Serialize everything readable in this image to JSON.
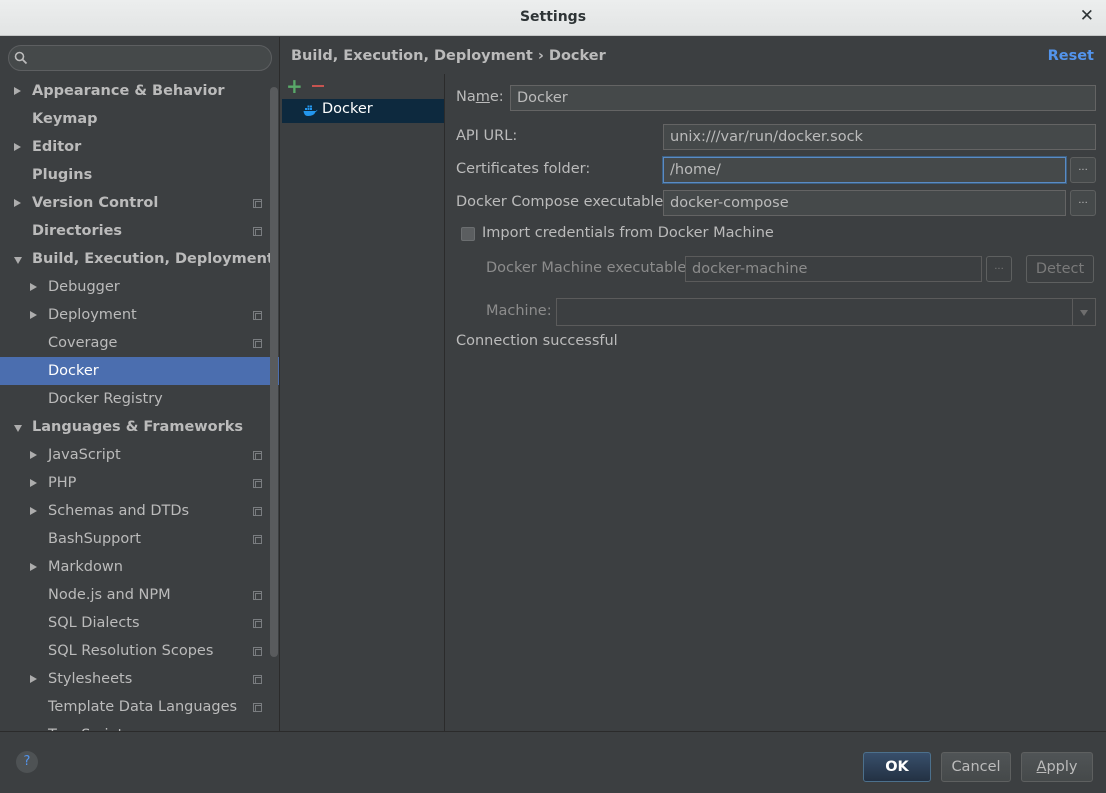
{
  "window": {
    "title": "Settings"
  },
  "search": {
    "placeholder": ""
  },
  "sidebar": {
    "items": [
      {
        "label": "Appearance & Behavior",
        "level": 0,
        "arrow": "right",
        "bold": true,
        "project": false
      },
      {
        "label": "Keymap",
        "level": 0,
        "arrow": "none",
        "bold": true,
        "project": false
      },
      {
        "label": "Editor",
        "level": 0,
        "arrow": "right",
        "bold": true,
        "project": false
      },
      {
        "label": "Plugins",
        "level": 0,
        "arrow": "none",
        "bold": true,
        "project": false
      },
      {
        "label": "Version Control",
        "level": 0,
        "arrow": "right",
        "bold": true,
        "project": true
      },
      {
        "label": "Directories",
        "level": 0,
        "arrow": "none",
        "bold": true,
        "project": true
      },
      {
        "label": "Build, Execution, Deployment",
        "level": 0,
        "arrow": "down",
        "bold": true,
        "project": false
      },
      {
        "label": "Debugger",
        "level": 1,
        "arrow": "right",
        "bold": false,
        "project": false
      },
      {
        "label": "Deployment",
        "level": 1,
        "arrow": "right",
        "bold": false,
        "project": true
      },
      {
        "label": "Coverage",
        "level": 1,
        "arrow": "none",
        "bold": false,
        "project": true
      },
      {
        "label": "Docker",
        "level": 1,
        "arrow": "none",
        "bold": false,
        "project": false,
        "selected": true
      },
      {
        "label": "Docker Registry",
        "level": 1,
        "arrow": "none",
        "bold": false,
        "project": false
      },
      {
        "label": "Languages & Frameworks",
        "level": 0,
        "arrow": "down",
        "bold": true,
        "project": false
      },
      {
        "label": "JavaScript",
        "level": 1,
        "arrow": "right",
        "bold": false,
        "project": true
      },
      {
        "label": "PHP",
        "level": 1,
        "arrow": "right",
        "bold": false,
        "project": true
      },
      {
        "label": "Schemas and DTDs",
        "level": 1,
        "arrow": "right",
        "bold": false,
        "project": true
      },
      {
        "label": "BashSupport",
        "level": 1,
        "arrow": "none",
        "bold": false,
        "project": true
      },
      {
        "label": "Markdown",
        "level": 1,
        "arrow": "right",
        "bold": false,
        "project": false
      },
      {
        "label": "Node.js and NPM",
        "level": 1,
        "arrow": "none",
        "bold": false,
        "project": true
      },
      {
        "label": "SQL Dialects",
        "level": 1,
        "arrow": "none",
        "bold": false,
        "project": true
      },
      {
        "label": "SQL Resolution Scopes",
        "level": 1,
        "arrow": "none",
        "bold": false,
        "project": true
      },
      {
        "label": "Stylesheets",
        "level": 1,
        "arrow": "right",
        "bold": false,
        "project": true
      },
      {
        "label": "Template Data Languages",
        "level": 1,
        "arrow": "none",
        "bold": false,
        "project": true
      },
      {
        "label": "TypeScript",
        "level": 1,
        "arrow": "none",
        "bold": false,
        "project": false
      }
    ]
  },
  "header": {
    "breadcrumb": "Build, Execution, Deployment › Docker",
    "reset_label": "Reset"
  },
  "servers": {
    "add_icon": "plus-icon",
    "remove_icon": "minus-icon",
    "items": [
      {
        "label": "Docker",
        "icon": "docker-whale-icon"
      }
    ]
  },
  "form": {
    "name_label_pre": "Na",
    "name_label_mnemonic": "m",
    "name_label_post": "e:",
    "name_value": "Docker",
    "api_url_label": "API URL:",
    "api_url_value": "unix:///var/run/docker.sock",
    "cert_label": "Certificates folder:",
    "cert_value": "/home/",
    "compose_label": "Docker Compose executable:",
    "compose_value": "docker-compose",
    "browse_label": "...",
    "import_label": "Import credentials from Docker Machine",
    "import_checked": false,
    "machine_exec_label": "Docker Machine executable:",
    "machine_exec_value": "docker-machine",
    "detect_label": "Detect",
    "machine_label": "Machine:",
    "machine_value": "",
    "status": "Connection successful"
  },
  "footer": {
    "help_label": "?",
    "ok_label": "OK",
    "cancel_label": "Cancel",
    "apply_label_mnemonic": "A",
    "apply_label_rest": "pply"
  },
  "colors": {
    "selection": "#4b6eaf",
    "accent_link": "#5394ec",
    "add": "#59a869",
    "remove": "#c75450"
  }
}
